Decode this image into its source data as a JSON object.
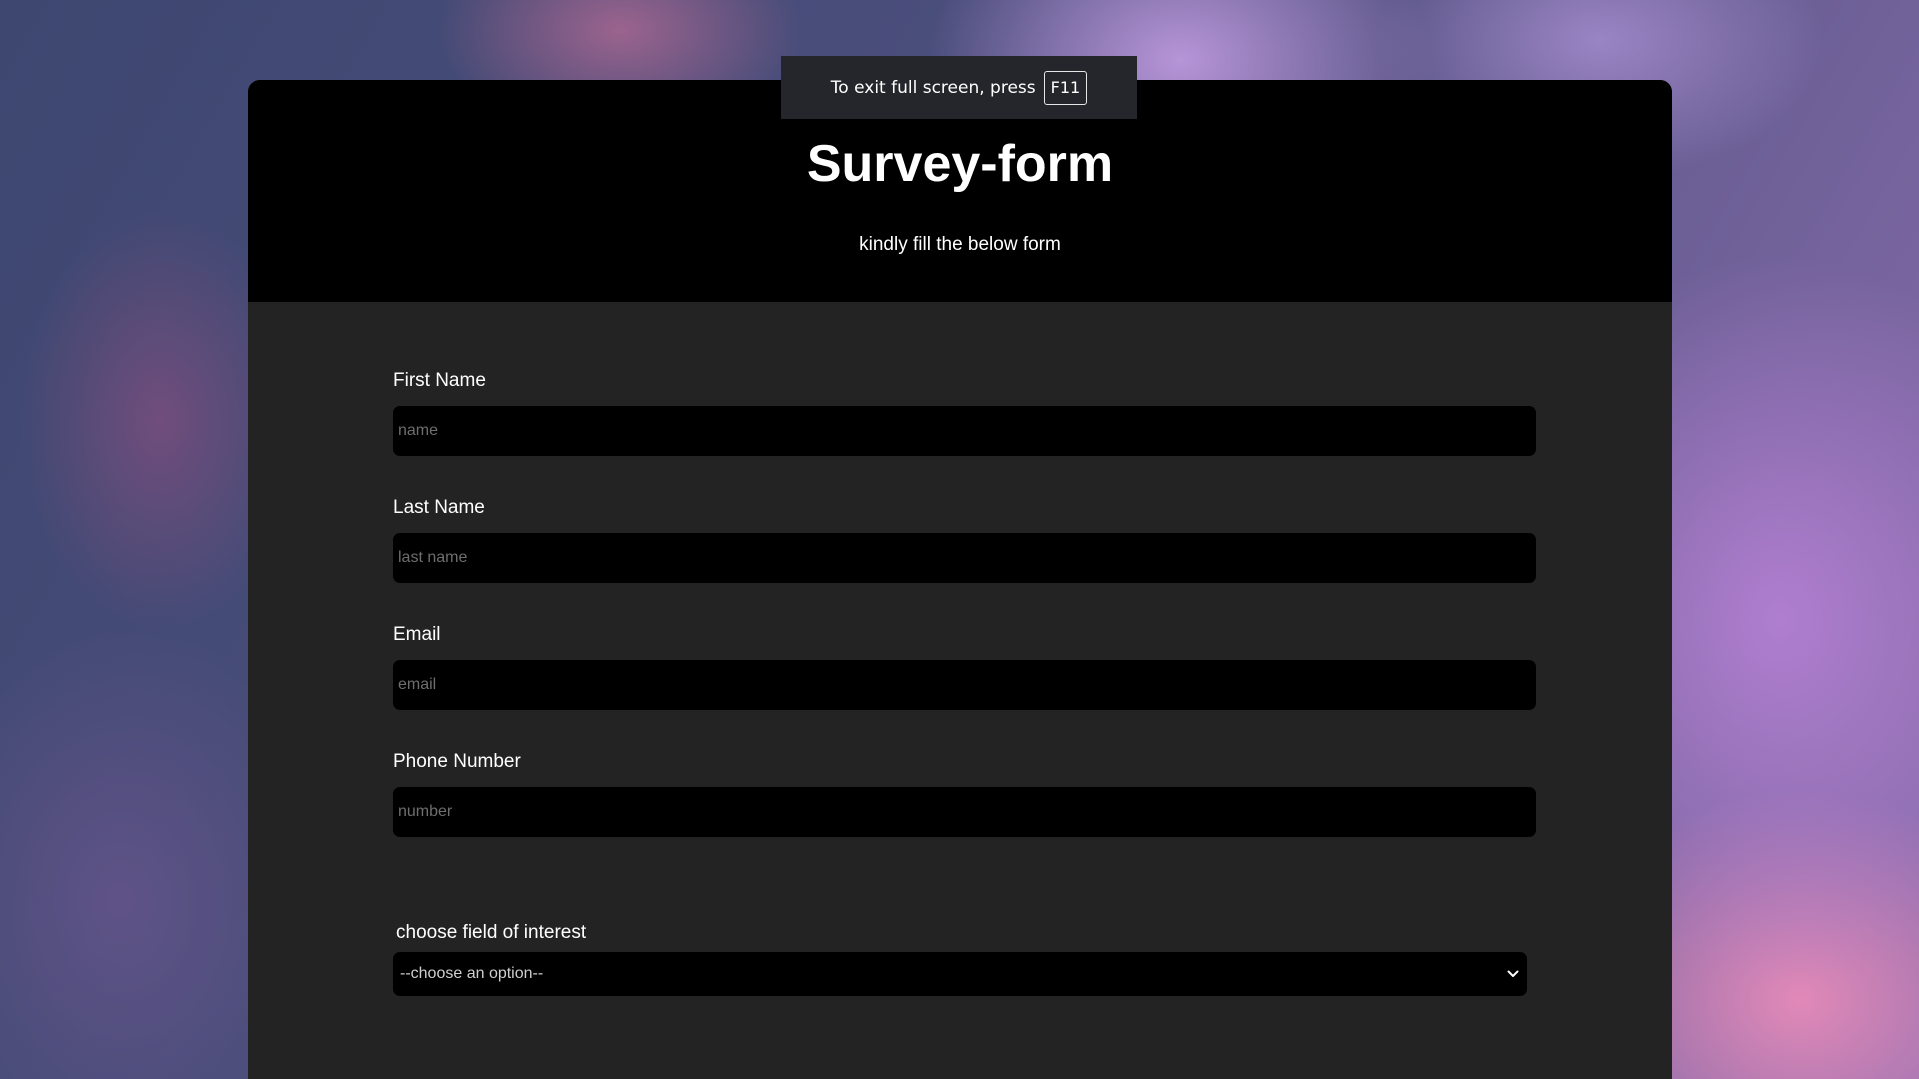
{
  "fullscreen_notice": {
    "text": "To exit full screen, press",
    "key": "F11"
  },
  "header": {
    "title": "Survey-form",
    "subtitle": "kindly fill the below form"
  },
  "form": {
    "first_name": {
      "label": "First Name",
      "placeholder": "name",
      "value": ""
    },
    "last_name": {
      "label": "Last Name",
      "placeholder": "last name",
      "value": ""
    },
    "email": {
      "label": "Email",
      "placeholder": "email",
      "value": ""
    },
    "phone": {
      "label": "Phone Number",
      "placeholder": "number",
      "value": ""
    },
    "interest": {
      "label": "choose field of interest",
      "selected": "--choose an option--",
      "icon": "chevron-down-icon"
    }
  },
  "colors": {
    "header_bg": "#000000",
    "panel_bg": "#232323",
    "input_bg": "#000000",
    "text": "#ffffff",
    "placeholder": "#6e6e6e"
  }
}
